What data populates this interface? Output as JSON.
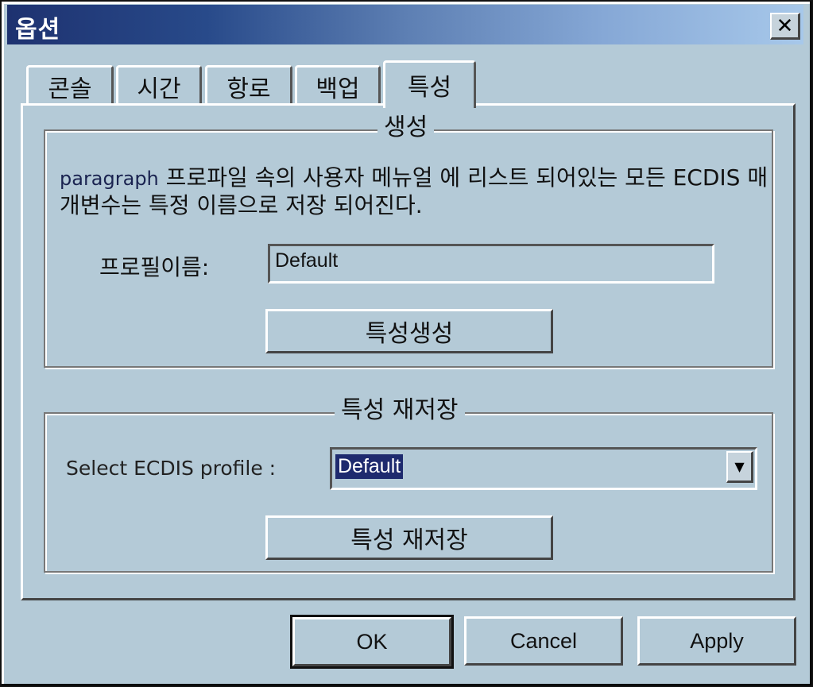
{
  "window": {
    "title": "옵션",
    "close_icon": "close-icon"
  },
  "tabs": [
    {
      "label": "콘솔",
      "active": false
    },
    {
      "label": "시간",
      "active": false
    },
    {
      "label": "항로",
      "active": false
    },
    {
      "label": "백업",
      "active": false
    },
    {
      "label": "특성",
      "active": true
    }
  ],
  "create_group": {
    "title": "생성",
    "description_en": "paragraph",
    "description": " 프로파일 속의 사용자 메뉴얼 에 리스트 되어있는 모든 ECDIS 매개변수는 특정 이름으로 저장 되어진다.",
    "profile_name_label": "프로필이름:",
    "profile_name_value": "Default",
    "create_button": "특성생성"
  },
  "restore_group": {
    "title": "특성 재저장",
    "select_label": "Select ECDIS profile :",
    "select_value": "Default",
    "dropdown_icon": "chevron-down-icon",
    "restore_button": "특성 재저장"
  },
  "footer": {
    "ok": "OK",
    "cancel": "Cancel",
    "apply": "Apply"
  }
}
